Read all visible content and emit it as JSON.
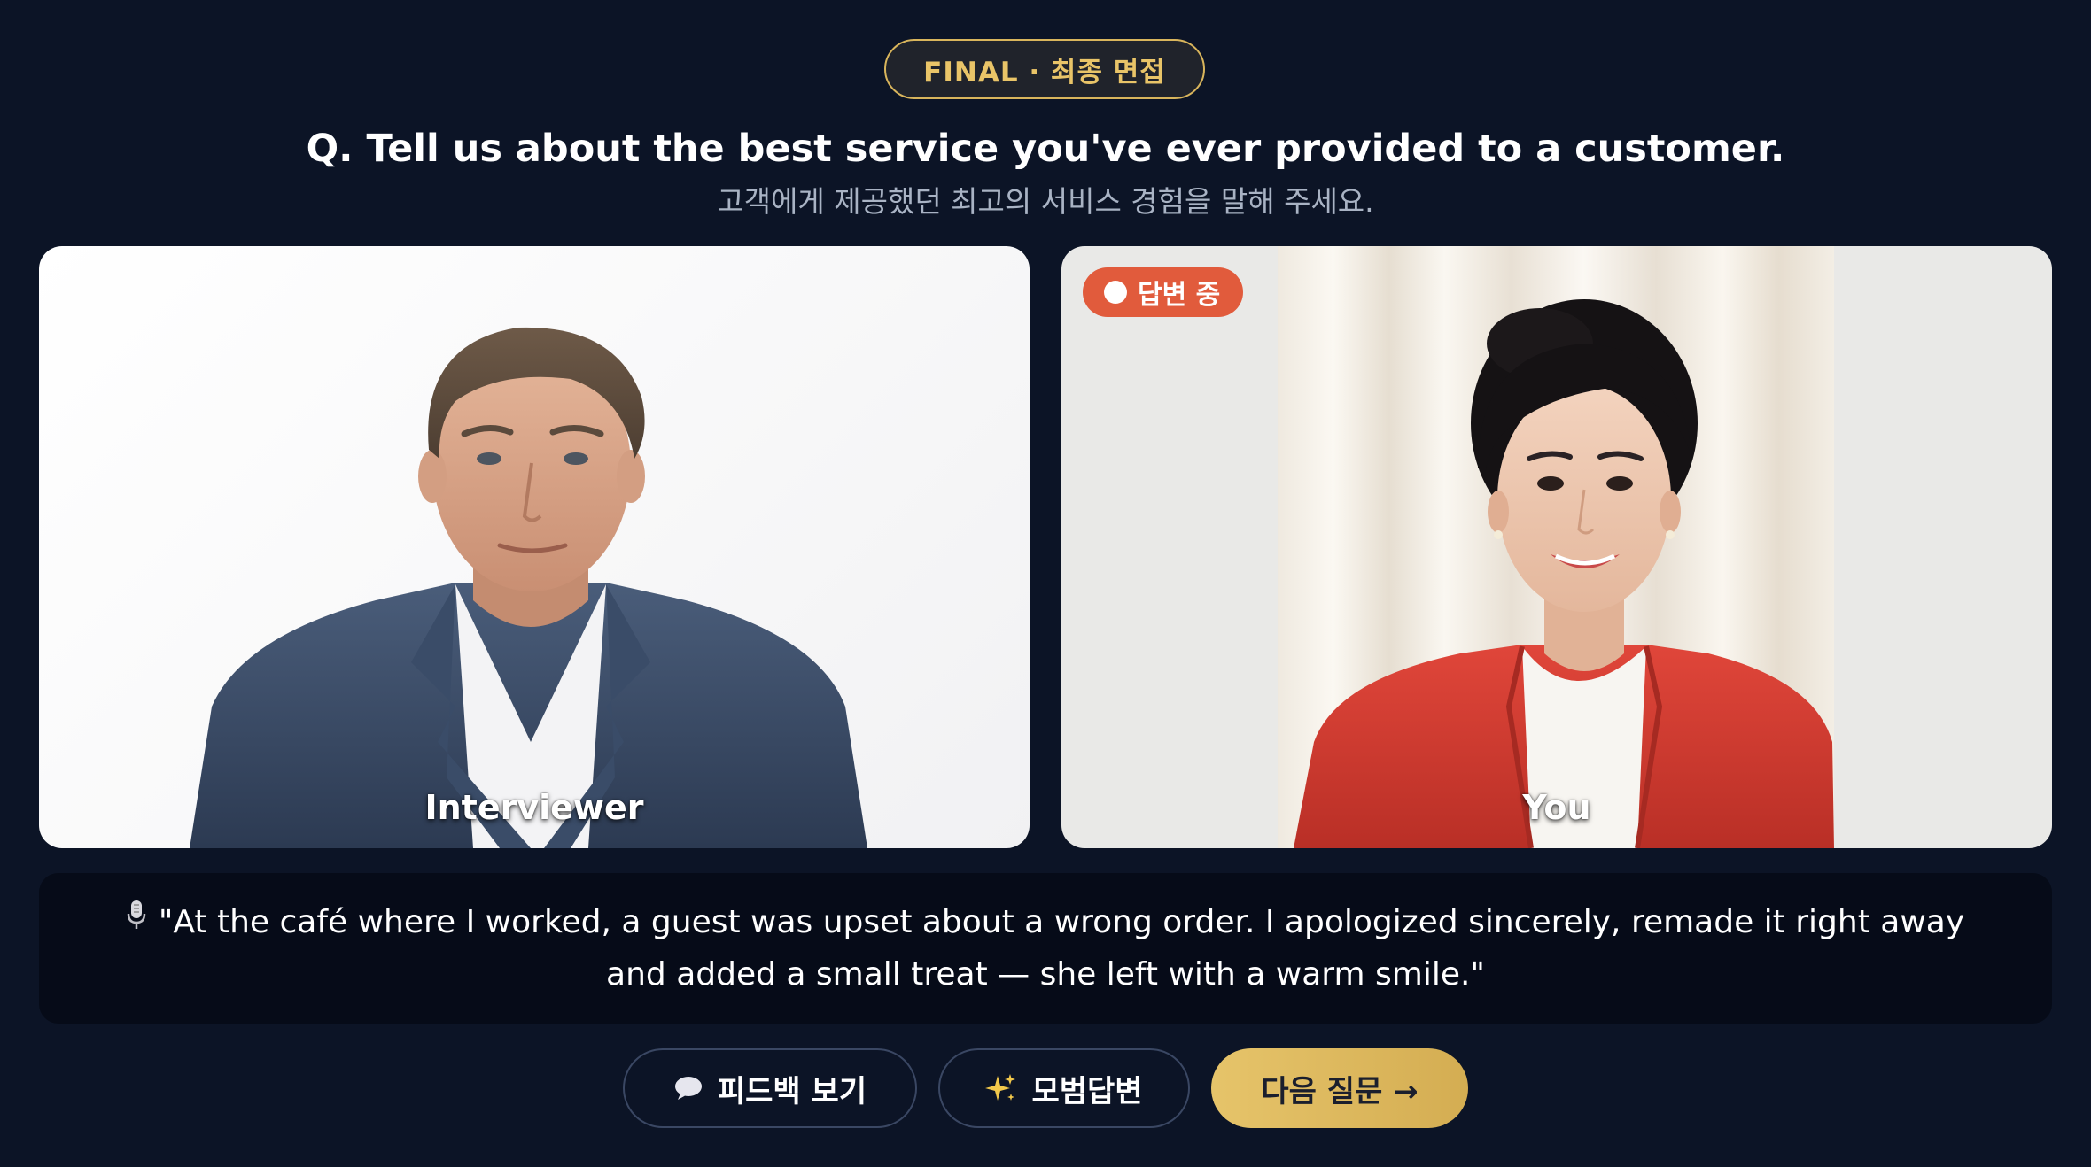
{
  "stage": {
    "badge_label": "FINAL · 최종 면접"
  },
  "question": {
    "english": "Q. Tell us about the best service you've ever provided to a customer.",
    "korean": "고객에게 제공했던 최고의 서비스 경험을 말해 주세요."
  },
  "panels": {
    "interviewer": {
      "label": "Interviewer"
    },
    "you": {
      "label": "You",
      "status_badge": "답변 중"
    }
  },
  "transcript": {
    "icon": "microphone-icon",
    "text": "\"At the café where I worked, a guest was upset about a wrong order. I apologized sincerely, remade it right away and added a small treat — she left with a warm smile.\""
  },
  "actions": {
    "feedback_label": "피드백 보기",
    "feedback_icon": "speech-bubble-icon",
    "model_answer_label": "모범답변",
    "model_answer_icon": "sparkles-icon",
    "next_label": "다음 질문 →"
  },
  "colors": {
    "background": "#0c1426",
    "accent_gold": "#e6c46a",
    "recording_red": "#e15b3c"
  }
}
